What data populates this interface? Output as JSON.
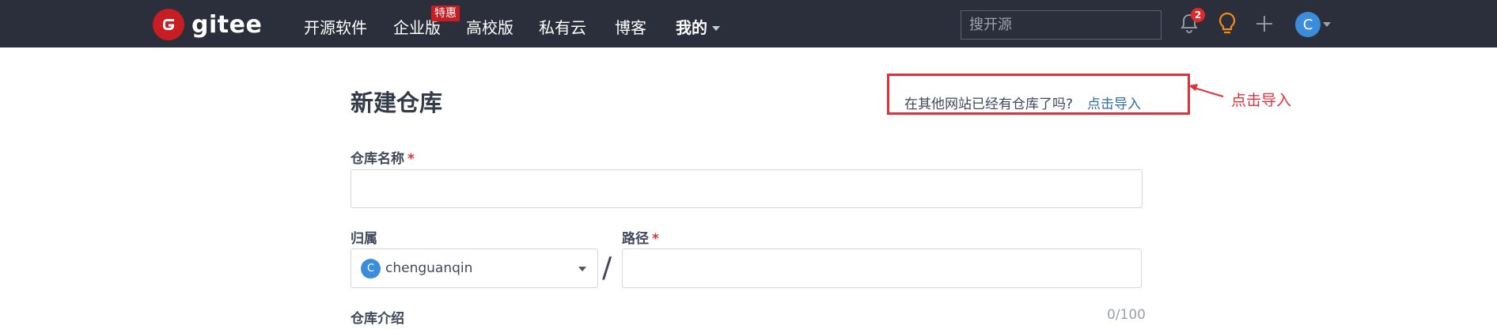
{
  "brand": {
    "name": "gitee"
  },
  "nav": {
    "items": [
      {
        "label": "开源软件"
      },
      {
        "label": "企业版"
      },
      {
        "label": "高校版"
      },
      {
        "label": "私有云"
      },
      {
        "label": "博客"
      },
      {
        "label": "我的"
      }
    ],
    "promo_badge": "特惠",
    "search_placeholder": "搜开源",
    "notification_count": "2",
    "avatar_initial": "C"
  },
  "page": {
    "title": "新建仓库",
    "import_question": "在其他网站已经有仓库了吗?",
    "import_link": "点击导入",
    "annotation": "点击导入"
  },
  "form": {
    "repo_name_label": "仓库名称",
    "required_mark": "*",
    "repo_name_value": "",
    "owner_label": "归属",
    "owner_avatar_initial": "C",
    "owner_value": "chenguanqin",
    "path_separator": "/",
    "path_label": "路径",
    "path_value": "",
    "description_label": "仓库介绍",
    "description_counter": "0/100"
  },
  "colors": {
    "topbar": "#2b2f3b",
    "brand_red": "#c71d23",
    "highlight_red": "#e0303a",
    "link_blue": "#2d6ea8",
    "avatar_blue": "#3b8ddb",
    "bulb_orange": "#f08a1c"
  }
}
